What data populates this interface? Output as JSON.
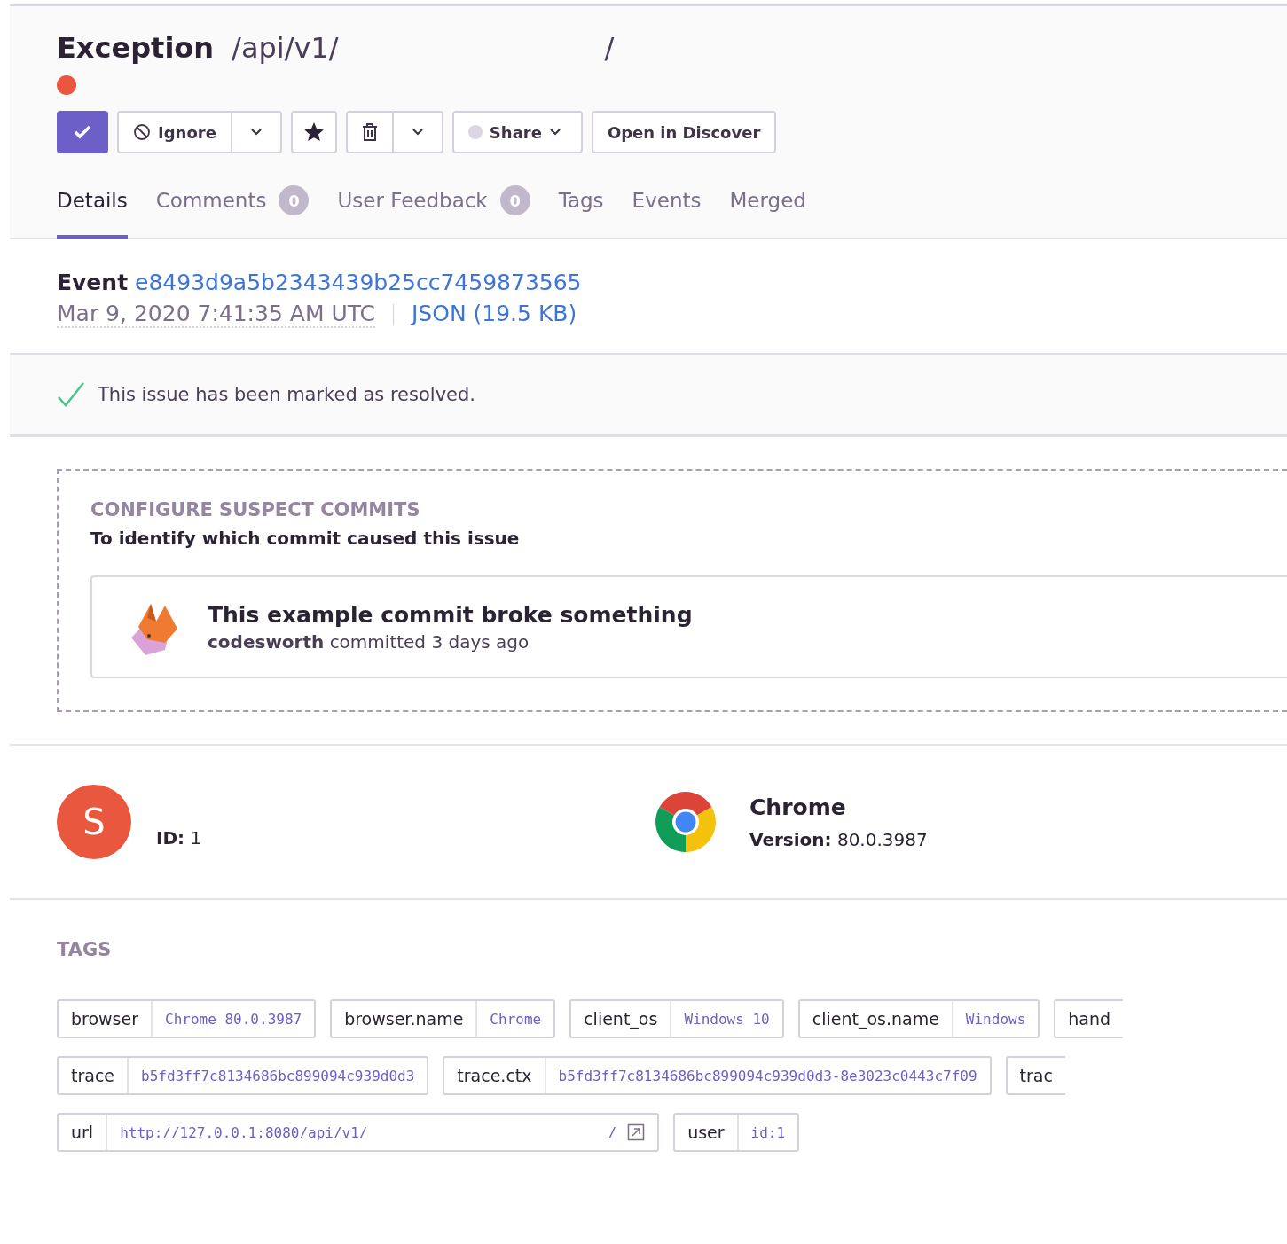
{
  "header": {
    "title": "Exception",
    "subtitle": "/api/v1/",
    "subtitle_tail": "/",
    "is_error": true
  },
  "actions": {
    "resolved": true,
    "ignore": "Ignore",
    "bookmarked": true,
    "share": "Share",
    "share_enabled": false,
    "discover": "Open in Discover"
  },
  "tabs": [
    {
      "label": "Details",
      "selected": true
    },
    {
      "label": "Comments",
      "count": "0",
      "selected": false
    },
    {
      "label": "User Feedback",
      "count": "0",
      "selected": false
    },
    {
      "label": "Tags",
      "selected": false
    },
    {
      "label": "Events",
      "selected": false
    },
    {
      "label": "Merged",
      "selected": false
    }
  ],
  "event": {
    "label": "Event",
    "id": "e8493d9a5b2343439b25cc7459873565",
    "date": "Mar 9, 2020 7:41:35 AM UTC",
    "json": "JSON (19.5 KB)"
  },
  "notice": {
    "text": "This issue has been marked as resolved."
  },
  "suspect_commits": {
    "heading": "CONFIGURE SUSPECT COMMITS",
    "subtitle": "To identify which commit caused this issue",
    "commit": {
      "message": "This example commit broke something",
      "author": "codesworth",
      "when": "committed 3 days ago"
    }
  },
  "user": {
    "initial": "S",
    "id_label": "ID:",
    "id": "1"
  },
  "browser": {
    "name": "Chrome",
    "version_label": "Version:",
    "version": "80.0.3987"
  },
  "tags": {
    "heading": "TAGS",
    "items": [
      {
        "key": "browser",
        "value": "Chrome 80.0.3987"
      },
      {
        "key": "browser.name",
        "value": "Chrome"
      },
      {
        "key": "client_os",
        "value": "Windows 10"
      },
      {
        "key": "client_os.name",
        "value": "Windows"
      },
      {
        "key": "hand"
      },
      {
        "key": "trace",
        "value": "b5fd3ff7c8134686bc899094c939d0d3"
      },
      {
        "key": "trace.ctx",
        "value": "b5fd3ff7c8134686bc899094c939d0d3-8e3023c0443c7f09"
      },
      {
        "key": "trac"
      },
      {
        "key": "url",
        "value": "http://127.0.0.1:8080/api/v1/",
        "value_tail": "/",
        "link": true
      },
      {
        "key": "user",
        "value": "id:1"
      }
    ]
  }
}
